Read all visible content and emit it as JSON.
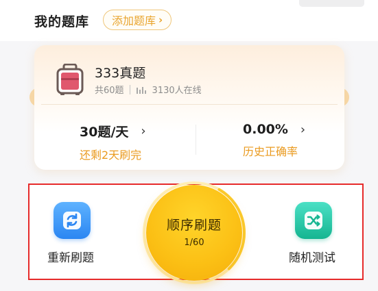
{
  "header": {
    "title": "我的题库",
    "add_button_label": "添加题库",
    "add_button_chevron": "›"
  },
  "bank": {
    "name": "333真题",
    "question_count_text": "共60题",
    "online_text": "3130人在线",
    "icon": "suitcase-icon",
    "icon_color": "#e0586e"
  },
  "stats": {
    "daily": {
      "value": "30题/天",
      "label": "还剩2天刷完"
    },
    "accuracy": {
      "value": "0.00%",
      "label": "历史正确率"
    },
    "chevron": "›"
  },
  "actions": {
    "restart": {
      "label": "重新刷题",
      "icon": "refresh-icon",
      "color": "#2b86f2"
    },
    "sequential": {
      "label": "顺序刷题",
      "progress_text": "1/60",
      "progress_fraction": 0.0167,
      "color": "#fbbf14"
    },
    "random": {
      "label": "随机测试",
      "icon": "shuffle-icon",
      "color": "#15b591"
    }
  },
  "colors": {
    "accent": "#ea9b21",
    "highlight_border": "#e62a2a"
  }
}
